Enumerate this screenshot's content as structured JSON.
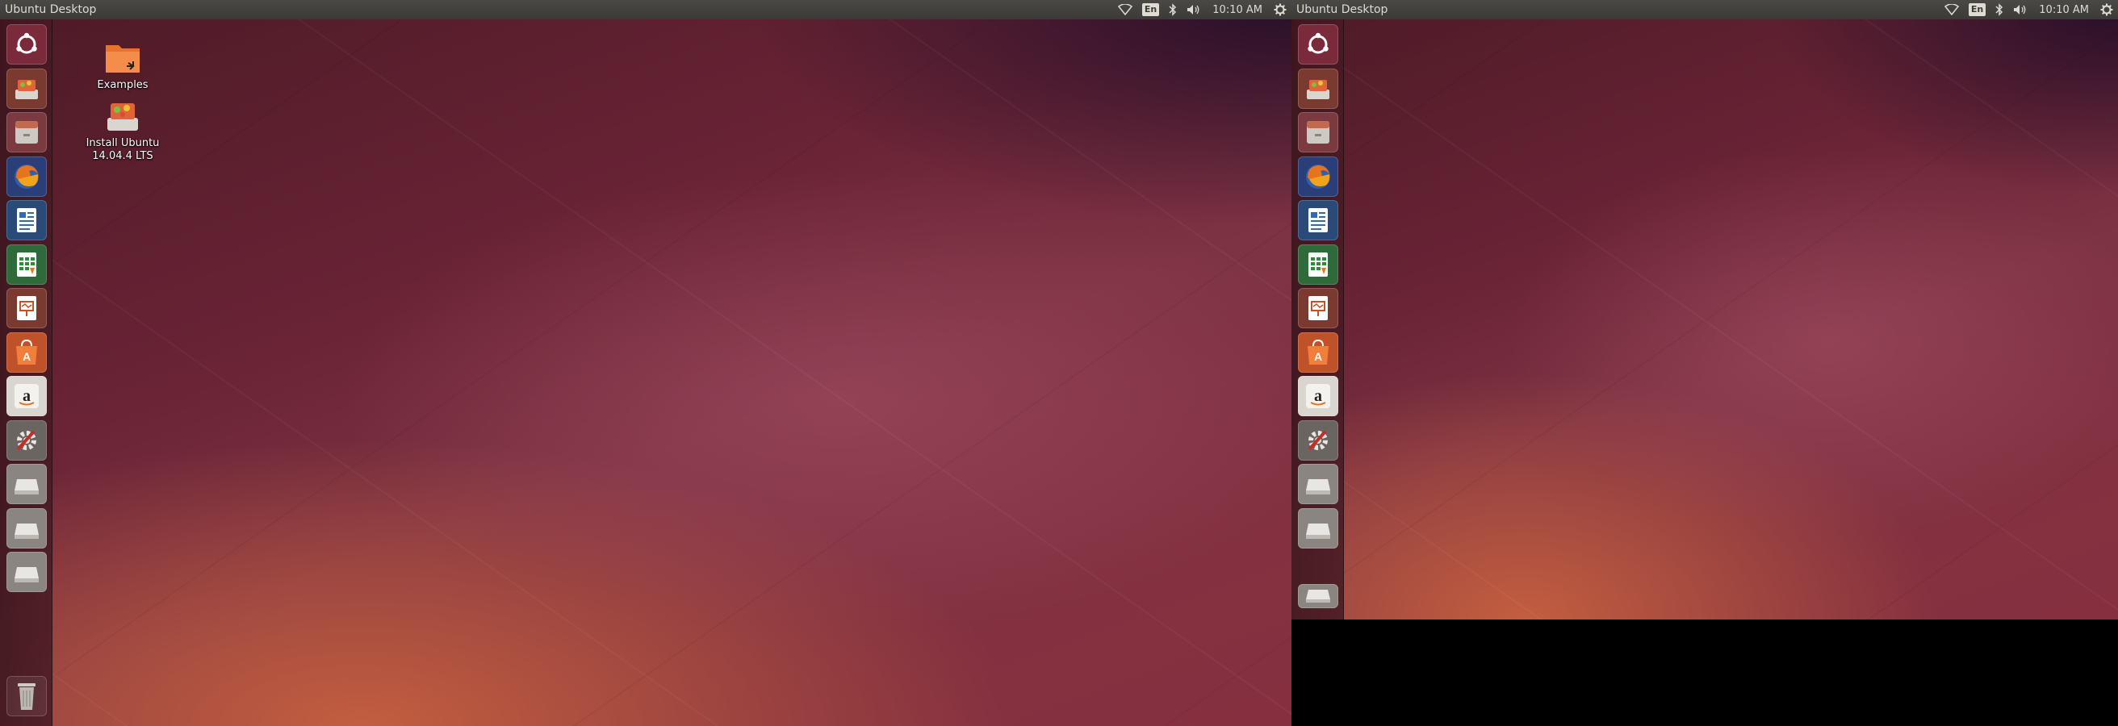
{
  "panel": {
    "title": "Ubuntu Desktop",
    "keyboard_layout": "En",
    "clock": "10:10 AM",
    "indicator_icons": [
      "network-wifi-icon",
      "keyboard-layout-indicator",
      "bluetooth-icon",
      "volume-icon",
      "gear-icon"
    ]
  },
  "desktop_icons": [
    {
      "label": "Examples",
      "icon": "folder-icon"
    },
    {
      "label": "Install Ubuntu\n14.04.4 LTS",
      "icon": "ubuntu-installer-icon"
    }
  ],
  "launcher_items": [
    {
      "name": "dash-home",
      "icon": "ubuntu-logo-icon"
    },
    {
      "name": "install-ubuntu",
      "icon": "ubuntu-installer-icon"
    },
    {
      "name": "files",
      "icon": "file-cabinet-icon"
    },
    {
      "name": "firefox",
      "icon": "firefox-icon"
    },
    {
      "name": "libreoffice-writer",
      "icon": "writer-icon"
    },
    {
      "name": "libreoffice-calc",
      "icon": "calc-icon"
    },
    {
      "name": "libreoffice-impress",
      "icon": "impress-icon"
    },
    {
      "name": "ubuntu-software-center",
      "icon": "software-center-icon"
    },
    {
      "name": "amazon",
      "icon": "amazon-icon"
    },
    {
      "name": "system-settings",
      "icon": "settings-icon"
    },
    {
      "name": "drive-1",
      "icon": "drive-icon"
    },
    {
      "name": "drive-2",
      "icon": "drive-icon"
    },
    {
      "name": "drive-3",
      "icon": "drive-icon"
    },
    {
      "name": "trash",
      "icon": "trash-icon"
    }
  ],
  "colors": {
    "panel_bg": "#3c3b37",
    "panel_text": "#dfdbd2",
    "launcher_bg": "#4a1c26",
    "wallpaper_dark": "#4d1a26",
    "wallpaper_orange": "#c8623e"
  }
}
